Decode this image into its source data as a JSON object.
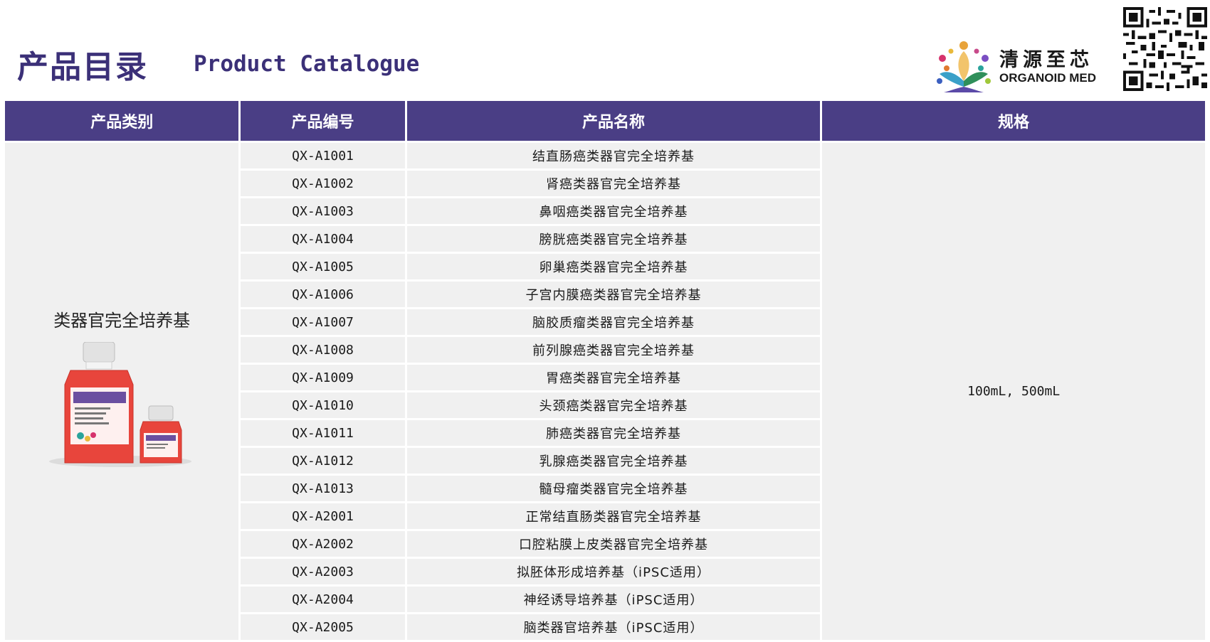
{
  "header": {
    "title_cn": "产品目录",
    "title_en": "Product Catalogue"
  },
  "brand": {
    "name_cn": "清源至芯",
    "name_en": "ORGANOID MED",
    "logo_icon": "organoid-med-logo-icon",
    "qr_icon": "qr-code-icon"
  },
  "table": {
    "headers": [
      "产品类别",
      "产品编号",
      "产品名称",
      "规格"
    ],
    "category": "类器官完全培养基",
    "spec": "100mL, 500mL",
    "rows": [
      {
        "code": "QX-A1001",
        "name": "结直肠癌类器官完全培养基"
      },
      {
        "code": "QX-A1002",
        "name": "肾癌类器官完全培养基"
      },
      {
        "code": "QX-A1003",
        "name": "鼻咽癌类器官完全培养基"
      },
      {
        "code": "QX-A1004",
        "name": "膀胱癌类器官完全培养基"
      },
      {
        "code": "QX-A1005",
        "name": "卵巢癌类器官完全培养基"
      },
      {
        "code": "QX-A1006",
        "name": "子宫内膜癌类器官完全培养基"
      },
      {
        "code": "QX-A1007",
        "name": "脑胶质瘤类器官完全培养基"
      },
      {
        "code": "QX-A1008",
        "name": "前列腺癌类器官完全培养基"
      },
      {
        "code": "QX-A1009",
        "name": "胃癌类器官完全培养基"
      },
      {
        "code": "QX-A1010",
        "name": "头颈癌类器官完全培养基"
      },
      {
        "code": "QX-A1011",
        "name": "肺癌类器官完全培养基"
      },
      {
        "code": "QX-A1012",
        "name": "乳腺癌类器官完全培养基"
      },
      {
        "code": "QX-A1013",
        "name": "髓母瘤类器官完全培养基"
      },
      {
        "code": "QX-A2001",
        "name": "正常结直肠类器官完全培养基"
      },
      {
        "code": "QX-A2002",
        "name": "口腔粘膜上皮类器官完全培养基"
      },
      {
        "code": "QX-A2003",
        "name": "拟胚体形成培养基（iPSC适用）"
      },
      {
        "code": "QX-A2004",
        "name": "神经诱导培养基（iPSC适用）"
      },
      {
        "code": "QX-A2005",
        "name": "脑类器官培养基（iPSC适用）"
      }
    ]
  },
  "colors": {
    "header_bg": "#4a3e85",
    "title": "#3b3078",
    "cell_bg": "#f0f0f0"
  }
}
